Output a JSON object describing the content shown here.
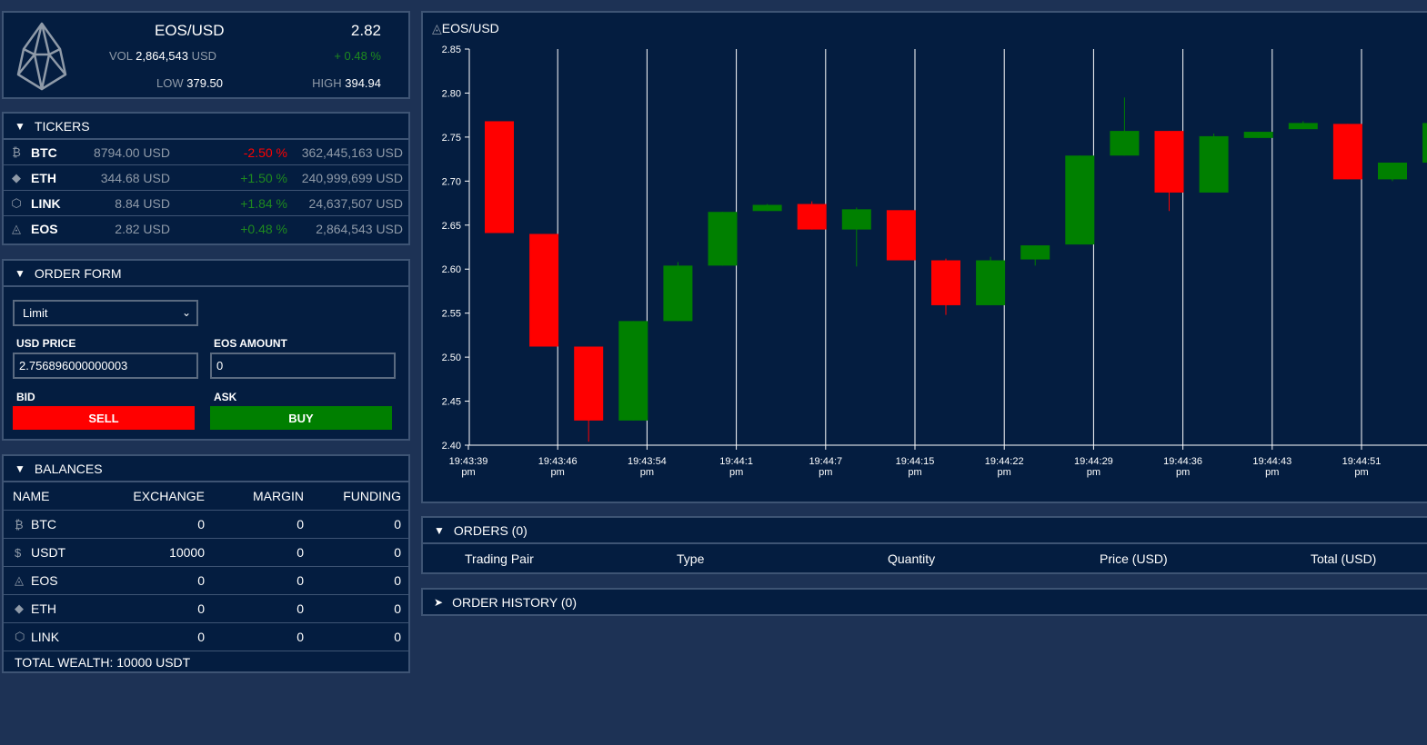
{
  "summary": {
    "pair": "EOS/USD",
    "price": "2.82",
    "vol_label": "VOL",
    "vol_value": "2,864,543",
    "vol_unit": "USD",
    "change": "+ 0.48 %",
    "low_label": "LOW",
    "low_value": "379.50",
    "high_label": "HIGH",
    "high_value": "394.94",
    "logo_icon": "eos-logo-icon"
  },
  "tickers": {
    "title": "TICKERS",
    "rows": [
      {
        "icon": "₿",
        "symbol": "BTC",
        "price": "8794.00 USD",
        "change": "-2.50 %",
        "dir": "down",
        "volume": "362,445,163 USD"
      },
      {
        "icon": "◆",
        "symbol": "ETH",
        "price": "344.68 USD",
        "change": "+1.50 %",
        "dir": "up",
        "volume": "240,999,699 USD"
      },
      {
        "icon": "⬡",
        "symbol": "LINK",
        "price": "8.84 USD",
        "change": "+1.84 %",
        "dir": "up",
        "volume": "24,637,507 USD"
      },
      {
        "icon": "◬",
        "symbol": "EOS",
        "price": "2.82 USD",
        "change": "+0.48 %",
        "dir": "up",
        "volume": "2,864,543 USD"
      }
    ]
  },
  "order_form": {
    "title": "ORDER FORM",
    "order_type": "Limit",
    "price_label": "USD PRICE",
    "price_value": "2.756896000000003",
    "amount_label": "EOS AMOUNT",
    "amount_value": "0",
    "bid_label": "BID",
    "ask_label": "ASK",
    "sell_label": "SELL",
    "buy_label": "BUY",
    "sell_color": "#ff0000",
    "buy_color": "#007f00"
  },
  "balances": {
    "title": "BALANCES",
    "headers": {
      "name": "NAME",
      "exchange": "EXCHANGE",
      "margin": "MARGIN",
      "funding": "FUNDING"
    },
    "rows": [
      {
        "icon": "₿",
        "name": "BTC",
        "exchange": "0",
        "margin": "0",
        "funding": "0"
      },
      {
        "icon": "$",
        "name": "USDT",
        "exchange": "10000",
        "margin": "0",
        "funding": "0"
      },
      {
        "icon": "◬",
        "name": "EOS",
        "exchange": "0",
        "margin": "0",
        "funding": "0"
      },
      {
        "icon": "◆",
        "name": "ETH",
        "exchange": "0",
        "margin": "0",
        "funding": "0"
      },
      {
        "icon": "⬡",
        "name": "LINK",
        "exchange": "0",
        "margin": "0",
        "funding": "0"
      }
    ],
    "total": "TOTAL WEALTH: 10000 USDT"
  },
  "chart": {
    "title": "EOS/USD"
  },
  "chart_data": {
    "type": "candlestick",
    "title": "EOS/USD",
    "ylim": [
      2.4,
      2.85
    ],
    "yticks": [
      "2.85",
      "2.80",
      "2.75",
      "2.70",
      "2.65",
      "2.60",
      "2.55",
      "2.50",
      "2.45",
      "2.40"
    ],
    "xticks": [
      {
        "time": "19:43:39",
        "suffix": "pm"
      },
      {
        "time": "19:43:46",
        "suffix": "pm"
      },
      {
        "time": "19:43:54",
        "suffix": "pm"
      },
      {
        "time": "19:44:1",
        "suffix": "pm"
      },
      {
        "time": "19:44:7",
        "suffix": "pm"
      },
      {
        "time": "19:44:15",
        "suffix": "pm"
      },
      {
        "time": "19:44:22",
        "suffix": "pm"
      },
      {
        "time": "19:44:29",
        "suffix": "pm"
      },
      {
        "time": "19:44:36",
        "suffix": "pm"
      },
      {
        "time": "19:44:43",
        "suffix": "pm"
      },
      {
        "time": "19:44:51",
        "suffix": "pm"
      }
    ],
    "grid": "vertical",
    "up_color": "#008000",
    "down_color": "#ff0000",
    "candles": [
      {
        "open": 2.768,
        "close": 2.641,
        "high": 2.768,
        "low": 2.641
      },
      {
        "open": 2.64,
        "close": 2.512,
        "high": 2.64,
        "low": 2.512
      },
      {
        "open": 2.512,
        "close": 2.428,
        "high": 2.512,
        "low": 2.404
      },
      {
        "open": 2.428,
        "close": 2.541,
        "high": 2.541,
        "low": 2.428
      },
      {
        "open": 2.541,
        "close": 2.604,
        "high": 2.608,
        "low": 2.541
      },
      {
        "open": 2.604,
        "close": 2.665,
        "high": 2.665,
        "low": 2.604
      },
      {
        "open": 2.666,
        "close": 2.673,
        "high": 2.674,
        "low": 2.666
      },
      {
        "open": 2.674,
        "close": 2.645,
        "high": 2.677,
        "low": 2.645
      },
      {
        "open": 2.645,
        "close": 2.668,
        "high": 2.67,
        "low": 2.603
      },
      {
        "open": 2.667,
        "close": 2.61,
        "high": 2.667,
        "low": 2.61
      },
      {
        "open": 2.61,
        "close": 2.559,
        "high": 2.612,
        "low": 2.548
      },
      {
        "open": 2.559,
        "close": 2.61,
        "high": 2.614,
        "low": 2.559
      },
      {
        "open": 2.611,
        "close": 2.627,
        "high": 2.627,
        "low": 2.604
      },
      {
        "open": 2.628,
        "close": 2.729,
        "high": 2.729,
        "low": 2.628
      },
      {
        "open": 2.729,
        "close": 2.757,
        "high": 2.795,
        "low": 2.729
      },
      {
        "open": 2.757,
        "close": 2.687,
        "high": 2.757,
        "low": 2.666
      },
      {
        "open": 2.687,
        "close": 2.751,
        "high": 2.754,
        "low": 2.687
      },
      {
        "open": 2.749,
        "close": 2.756,
        "high": 2.756,
        "low": 2.749
      },
      {
        "open": 2.759,
        "close": 2.766,
        "high": 2.768,
        "low": 2.759
      },
      {
        "open": 2.765,
        "close": 2.702,
        "high": 2.765,
        "low": 2.702
      },
      {
        "open": 2.702,
        "close": 2.721,
        "high": 2.721,
        "low": 2.7
      },
      {
        "open": 2.721,
        "close": 2.766,
        "high": 2.766,
        "low": 2.721
      }
    ]
  },
  "orders": {
    "title": "ORDERS (0)",
    "columns": [
      "Trading Pair",
      "Type",
      "Quantity",
      "Price (USD)",
      "Total (USD)"
    ]
  },
  "order_history": {
    "title": "ORDER HISTORY (0)"
  }
}
